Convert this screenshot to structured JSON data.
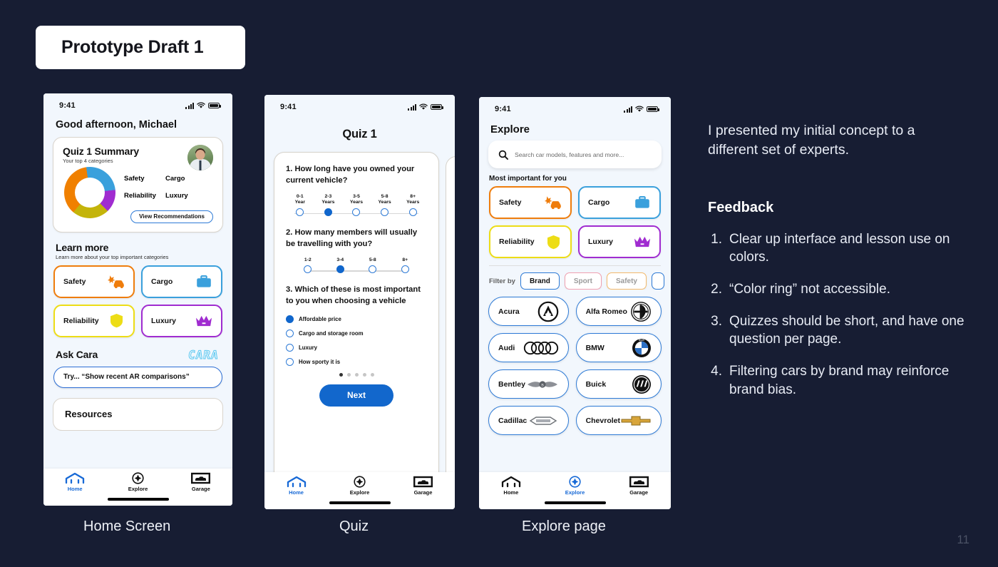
{
  "slide": {
    "title": "Prototype Draft 1",
    "page_number": "11",
    "background_color": "#171d33"
  },
  "captions": {
    "phone1": "Home Screen",
    "phone2": "Quiz",
    "phone3": "Explore page"
  },
  "status_bar": {
    "time": "9:41"
  },
  "tabbar": {
    "home": "Home",
    "explore": "Explore",
    "garage": "Garage"
  },
  "phone1": {
    "greeting": "Good afternoon, Michael",
    "summary": {
      "title": "Quiz 1 Summary",
      "subtitle": "Your top 4 categories",
      "button": "View Recommendations",
      "legend": [
        {
          "label": "Safety",
          "color": "#f08000"
        },
        {
          "label": "Cargo",
          "color": "#3aa0dc"
        },
        {
          "label": "Reliability",
          "color": "#c4b40a"
        },
        {
          "label": "Luxury",
          "color": "#a02cd0"
        }
      ]
    },
    "learn": {
      "heading": "Learn more",
      "subheading": "Learn more about your top important categories"
    },
    "categories": [
      {
        "label": "Safety",
        "color": "#ef7d0c",
        "icon": "car-crash-icon"
      },
      {
        "label": "Cargo",
        "color": "#3aa0dc",
        "icon": "briefcase-icon"
      },
      {
        "label": "Reliability",
        "color": "#eddd16",
        "icon": "shield-icon"
      },
      {
        "label": "Luxury",
        "color": "#a02cd0",
        "icon": "crown-icon"
      }
    ],
    "ask": {
      "heading": "Ask Cara",
      "logo": "CARA",
      "prompt": "Try... “Show recent AR comparisons”"
    },
    "resources": {
      "title": "Resources"
    }
  },
  "phone2": {
    "title": "Quiz 1",
    "questions": [
      {
        "text": "1. How long have you owned your current vehicle?",
        "type": "slider",
        "options": [
          "0-1\nYear",
          "2-3\nYears",
          "3-5\nYears",
          "5-8\nYears",
          "8+\nYears"
        ],
        "selected_index": 1
      },
      {
        "text": "2. How many members will usually be travelling with you?",
        "type": "slider",
        "options": [
          "1-2",
          "3-4",
          "5-8",
          "8+"
        ],
        "selected_index": 1
      },
      {
        "text": "3. Which of these is most important to you when choosing a vehicle",
        "type": "radio",
        "options": [
          "Affordable price",
          "Cargo and storage room",
          "Luxury",
          "How sporty it is"
        ],
        "selected_index": 0
      }
    ],
    "pager": {
      "total": 5,
      "current": 1
    },
    "next_button": "Next"
  },
  "phone3": {
    "title": "Explore",
    "search_placeholder": "Search car models, features and more...",
    "most_important_heading": "Most important for you",
    "categories": [
      {
        "label": "Safety",
        "color": "#ef7d0c",
        "icon": "car-crash-icon"
      },
      {
        "label": "Cargo",
        "color": "#3aa0dc",
        "icon": "briefcase-icon"
      },
      {
        "label": "Reliability",
        "color": "#eddd16",
        "icon": "shield-icon"
      },
      {
        "label": "Luxury",
        "color": "#a02cd0",
        "icon": "crown-icon"
      }
    ],
    "filter_label": "Filter by",
    "filters": [
      {
        "label": "Brand",
        "active": true,
        "color": "#2d7ad6"
      },
      {
        "label": "Sport",
        "active": false,
        "color": "#f0a0b0"
      },
      {
        "label": "Safety",
        "active": false,
        "color": "#f3b96b"
      }
    ],
    "brands": [
      {
        "label": "Acura",
        "icon": "acura-logo"
      },
      {
        "label": "Alfa Romeo",
        "icon": "alfa-romeo-logo"
      },
      {
        "label": "Audi",
        "icon": "audi-logo"
      },
      {
        "label": "BMW",
        "icon": "bmw-logo"
      },
      {
        "label": "Bentley",
        "icon": "bentley-logo"
      },
      {
        "label": "Buick",
        "icon": "buick-logo"
      },
      {
        "label": "Cadillac",
        "icon": "cadillac-logo"
      },
      {
        "label": "Chevrolet",
        "icon": "chevrolet-logo"
      }
    ]
  },
  "right_panel": {
    "intro": "I presented my initial concept to a different set of experts.",
    "feedback_heading": "Feedback",
    "feedback_items": [
      {
        "num": "1.",
        "text": "Clear up interface and lesson use on colors."
      },
      {
        "num": "2.",
        "text": "“Color ring” not accessible."
      },
      {
        "num": "3.",
        "text": "Quizzes should be short, and have one question per page."
      },
      {
        "num": "4.",
        "text": "Filtering cars by brand may reinforce brand bias."
      }
    ]
  }
}
